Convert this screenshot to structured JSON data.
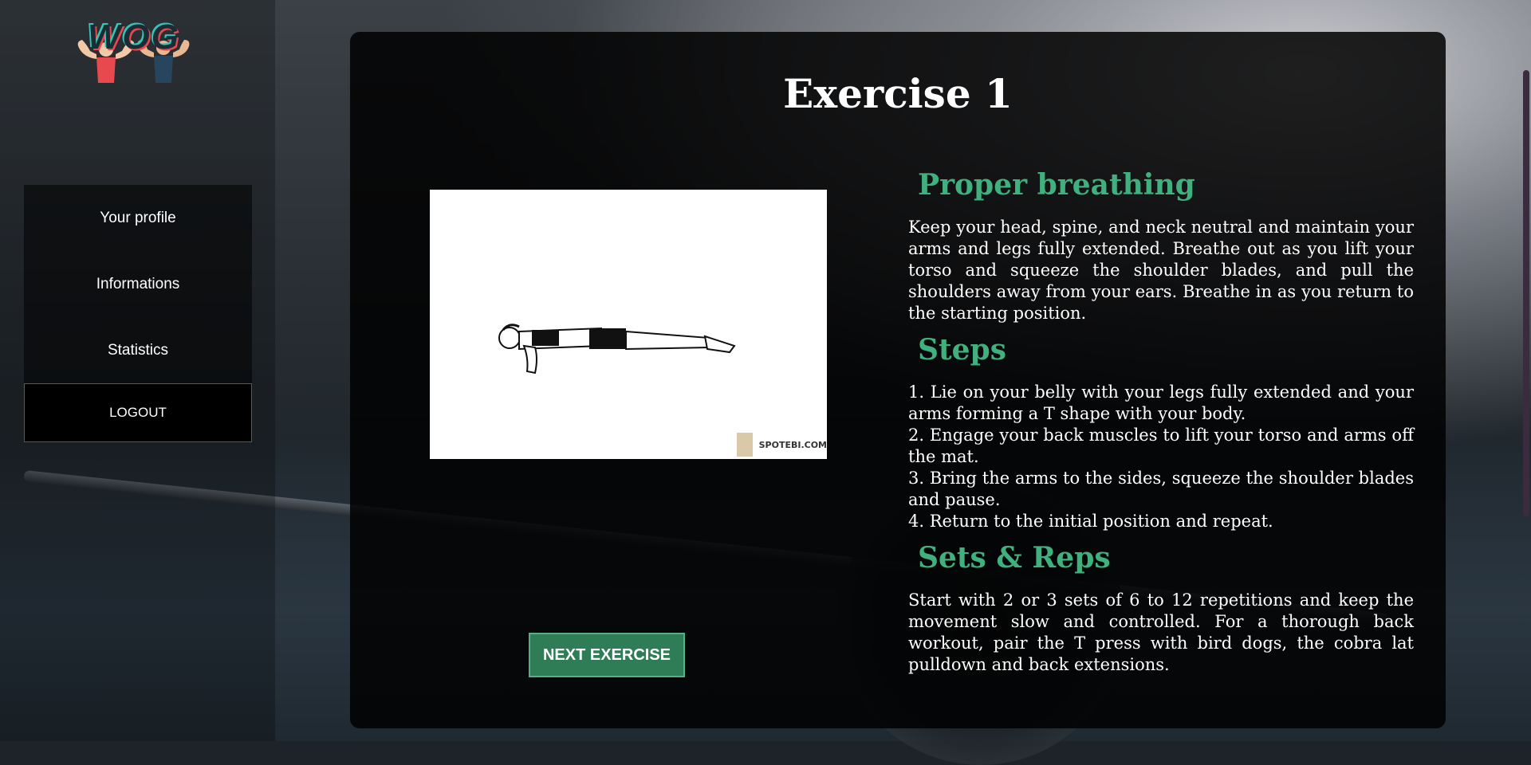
{
  "logo": {
    "text": "WOG"
  },
  "sidebar": {
    "items": [
      {
        "label": "Your profile"
      },
      {
        "label": "Informations"
      },
      {
        "label": "Statistics"
      }
    ],
    "logout_label": "LOGOUT"
  },
  "exercise": {
    "title": "Exercise 1",
    "image": {
      "watermark": "SPOTEBI.COM"
    },
    "next_label": "NEXT EXERCISE",
    "sections": {
      "breathing": {
        "heading": "Proper breathing",
        "text": "Keep your head, spine, and neck neutral and maintain your arms and legs fully extended. Breathe out as you lift your torso and squeeze the shoulder blades, and pull the shoulders away from your ears. Breathe in as you return to the starting position."
      },
      "steps": {
        "heading": "Steps",
        "items": [
          "1. Lie on your belly with your legs fully extended and your arms forming a T shape with your body.",
          "2. Engage your back muscles to lift your torso and arms off the mat.",
          "3. Bring the arms to the sides, squeeze the shoulder blades and pause.",
          "4. Return to the initial position and repeat."
        ]
      },
      "sets": {
        "heading": "Sets & Reps",
        "text": "Start with 2 or 3 sets of 6 to 12 repetitions and keep the movement slow and controlled. For a thorough back workout, pair the T press with bird dogs, the cobra lat pulldown and back extensions."
      }
    }
  },
  "colors": {
    "accent": "#3fb07e",
    "button": "#2e7d57"
  }
}
